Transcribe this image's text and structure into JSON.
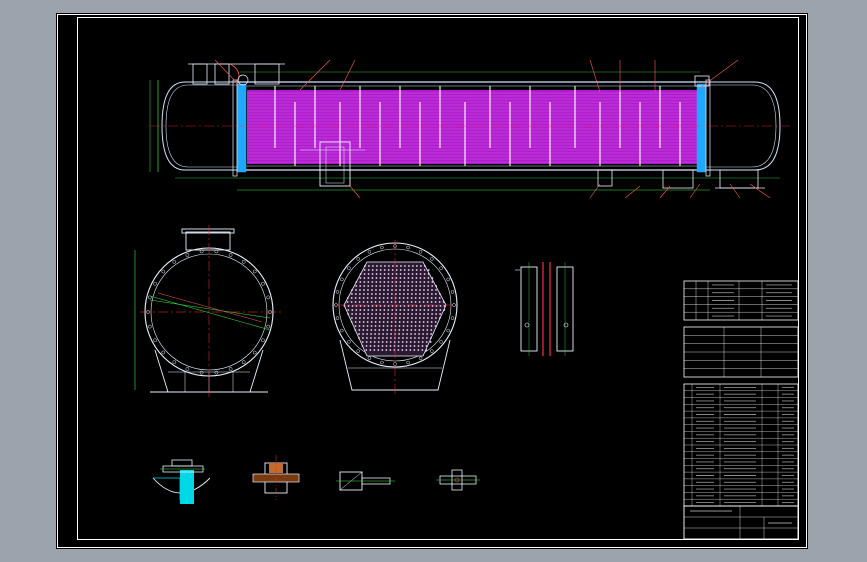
{
  "drawing": {
    "background": "#000000",
    "viewport_color": "#9da3ad",
    "colors": {
      "frame": "#ffffff",
      "outline": "#e8f2ff",
      "shell": "#cfe6ff",
      "tube_fill": "#b21bd0",
      "tube_line": "#ffffff",
      "center_line": "#ff2b3a",
      "dimension": "#3de63d",
      "leader": "#ff5a5a",
      "tube_sheet": "#1ea8ff",
      "nozzle_fill": "#00d8e8",
      "perforation": "#f3d7ff",
      "title_block": "#ffffff"
    }
  },
  "views": [
    {
      "id": "main-elevation",
      "kind": "heat-exchanger-elevation"
    },
    {
      "id": "section-a",
      "kind": "shell-cross-section"
    },
    {
      "id": "section-b",
      "kind": "tube-sheet-section"
    },
    {
      "id": "baffle-detail",
      "kind": "detail"
    },
    {
      "id": "detail-1",
      "kind": "detail"
    },
    {
      "id": "detail-2",
      "kind": "detail"
    },
    {
      "id": "detail-3",
      "kind": "detail"
    },
    {
      "id": "detail-4",
      "kind": "detail"
    }
  ],
  "title_block": {
    "nozzle_table_rows": 4,
    "spec_table_rows": 5,
    "parts_table_rows": 18
  }
}
